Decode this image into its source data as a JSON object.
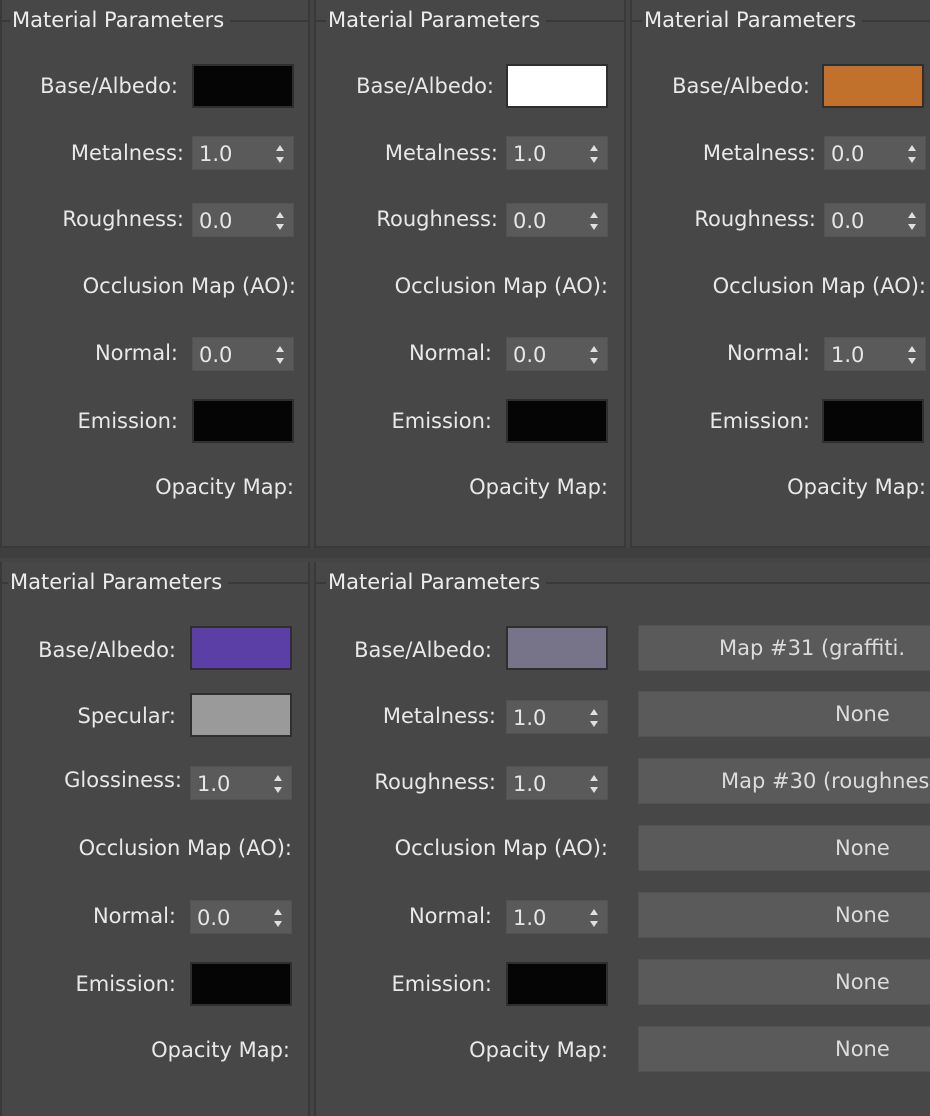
{
  "panels": {
    "p1": {
      "title": "Material Parameters",
      "base_label": "Base/Albedo:",
      "base_color": "#050505",
      "metalness_label": "Metalness:",
      "metalness_value": "1.0",
      "roughness_label": "Roughness:",
      "roughness_value": "0.0",
      "occlusion_label": "Occlusion Map (AO):",
      "normal_label": "Normal:",
      "normal_value": "0.0",
      "emission_label": "Emission:",
      "emission_color": "#050505",
      "opacity_label": "Opacity Map:"
    },
    "p2": {
      "title": "Material Parameters",
      "base_label": "Base/Albedo:",
      "base_color": "#ffffff",
      "metalness_label": "Metalness:",
      "metalness_value": "1.0",
      "roughness_label": "Roughness:",
      "roughness_value": "0.0",
      "occlusion_label": "Occlusion Map (AO):",
      "normal_label": "Normal:",
      "normal_value": "0.0",
      "emission_label": "Emission:",
      "emission_color": "#050505",
      "opacity_label": "Opacity Map:"
    },
    "p3": {
      "title": "Material Parameters",
      "base_label": "Base/Albedo:",
      "base_color": "#c2712c",
      "metalness_label": "Metalness:",
      "metalness_value": "0.0",
      "roughness_label": "Roughness:",
      "roughness_value": "0.0",
      "occlusion_label": "Occlusion Map (AO):",
      "normal_label": "Normal:",
      "normal_value": "1.0",
      "emission_label": "Emission:",
      "emission_color": "#050505",
      "opacity_label": "Opacity Map:"
    },
    "p4": {
      "title": "Material Parameters",
      "base_label": "Base/Albedo:",
      "base_color": "#5b3fa6",
      "specular_label": "Specular:",
      "specular_color": "#9a9a9a",
      "glossiness_label": "Glossiness:",
      "glossiness_value": "1.0",
      "occlusion_label": "Occlusion Map (AO):",
      "normal_label": "Normal:",
      "normal_value": "0.0",
      "emission_label": "Emission:",
      "emission_color": "#050505",
      "opacity_label": "Opacity Map:"
    },
    "p5": {
      "title": "Material Parameters",
      "base_label": "Base/Albedo:",
      "base_color": "#77748a",
      "base_map": "Map #31 (graffiti.",
      "metalness_label": "Metalness:",
      "metalness_value": "1.0",
      "metalness_map": "None",
      "roughness_label": "Roughness:",
      "roughness_value": "1.0",
      "roughness_map": "Map #30 (roughnes",
      "occlusion_label": "Occlusion Map (AO):",
      "occlusion_map": "None",
      "normal_label": "Normal:",
      "normal_value": "1.0",
      "normal_map": "None",
      "emission_label": "Emission:",
      "emission_color": "#050505",
      "emission_map": "None",
      "opacity_label": "Opacity Map:",
      "opacity_map": "None"
    }
  },
  "icons": {
    "spinner": "spinner-arrows-icon"
  }
}
